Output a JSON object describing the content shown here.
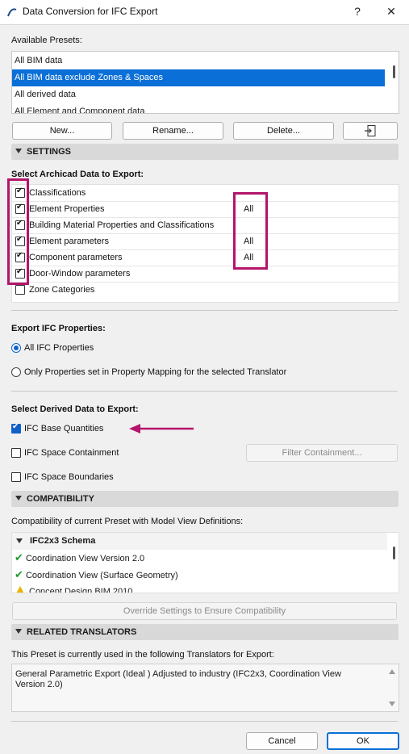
{
  "window": {
    "title": "Data Conversion for IFC Export",
    "help_label": "?",
    "close_label": "✕"
  },
  "presets": {
    "label": "Available Presets:",
    "items": [
      {
        "label": "All BIM data",
        "selected": false
      },
      {
        "label": "All BIM data exclude Zones & Spaces",
        "selected": true
      },
      {
        "label": "All derived data",
        "selected": false
      },
      {
        "label": "All Element and Component data",
        "selected": false
      }
    ],
    "buttons": {
      "new": "New...",
      "rename": "Rename...",
      "delete": "Delete..."
    }
  },
  "settings": {
    "header": "SETTINGS",
    "select_label": "Select Archicad Data to Export:",
    "items": [
      {
        "label": "Classifications",
        "checked": true,
        "value": ""
      },
      {
        "label": "Element Properties",
        "checked": true,
        "value": "All"
      },
      {
        "label": "Building Material Properties and Classifications",
        "checked": true,
        "value": ""
      },
      {
        "label": "Element parameters",
        "checked": true,
        "value": "All"
      },
      {
        "label": "Component parameters",
        "checked": true,
        "value": "All"
      },
      {
        "label": "Door-Window parameters",
        "checked": true,
        "value": ""
      },
      {
        "label": "Zone Categories",
        "checked": false,
        "value": ""
      }
    ]
  },
  "ifc_properties": {
    "label": "Export IFC Properties:",
    "options": [
      {
        "label": "All IFC Properties",
        "selected": true
      },
      {
        "label": "Only Properties set in Property Mapping for the selected Translator",
        "selected": false
      }
    ]
  },
  "derived": {
    "label": "Select Derived Data to Export:",
    "base_quantities": {
      "label": "IFC Base Quantities",
      "checked": true
    },
    "space_containment": {
      "label": "IFC Space Containment",
      "checked": false
    },
    "filter_button": "Filter Containment...",
    "space_boundaries": {
      "label": "IFC Space Boundaries",
      "checked": false
    }
  },
  "compatibility": {
    "header": "COMPATIBILITY",
    "description": "Compatibility of current Preset with Model View Definitions:",
    "schema": "IFC2x3 Schema",
    "items": [
      {
        "label": "Coordination View Version 2.0",
        "status": "ok"
      },
      {
        "label": "Coordination View (Surface Geometry)",
        "status": "ok"
      },
      {
        "label": "Concept Design BIM 2010",
        "status": "warning"
      }
    ],
    "override_button": "Override Settings to Ensure Compatibility"
  },
  "translators": {
    "header": "RELATED TRANSLATORS",
    "description": "This Preset is currently used in the following Translators for Export:",
    "text": "General Parametric Export (Ideal ) Adjusted to industry (IFC2x3, Coordination View Version 2.0)"
  },
  "footer": {
    "cancel": "Cancel",
    "ok": "OK"
  },
  "colors": {
    "accent": "#0a6fd6",
    "highlight": "#b4146b",
    "ok": "#1a9b2a",
    "warning": "#e8b400"
  }
}
